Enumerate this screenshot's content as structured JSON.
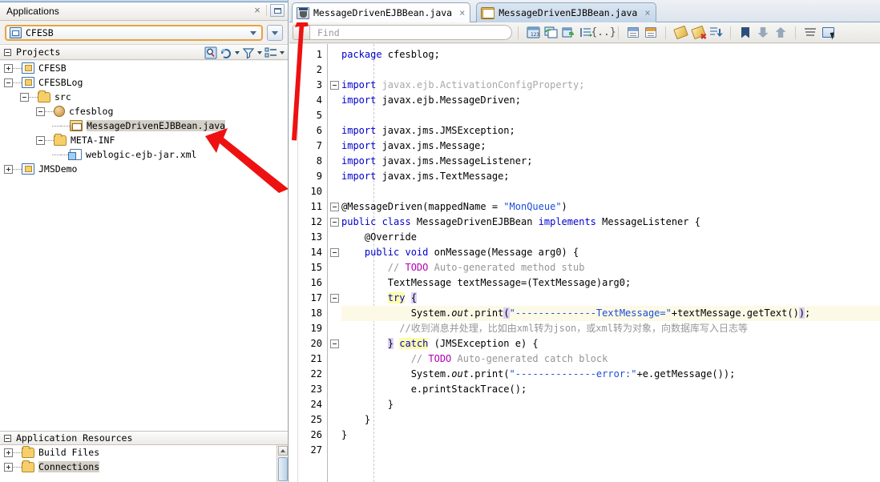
{
  "left_panel": {
    "title": "Applications",
    "close_label": "×",
    "minimize_name": "minimize-button",
    "app_combo": {
      "value": "CFESB",
      "icon": "application-icon"
    },
    "projects_header": {
      "label": "Projects"
    },
    "toolbar_icons": [
      "search-icon",
      "refresh-icon",
      "filter-icon",
      "group-by-icon"
    ],
    "tree": [
      {
        "label": "CFESB",
        "icon": "project-icon",
        "depth": 0,
        "expander": "plus",
        "selected": false
      },
      {
        "label": "CFESBLog",
        "icon": "project-icon",
        "depth": 0,
        "expander": "minus",
        "selected": false
      },
      {
        "label": "src",
        "icon": "folder-icon",
        "depth": 1,
        "expander": "minus",
        "selected": false
      },
      {
        "label": "cfesblog",
        "icon": "package-icon",
        "depth": 2,
        "expander": "minus",
        "selected": false
      },
      {
        "label": "MessageDrivenEJBBean.java",
        "icon": "java-file-icon",
        "depth": 3,
        "expander": "none",
        "selected": true
      },
      {
        "label": "META-INF",
        "icon": "folder-icon",
        "depth": 2,
        "expander": "minus",
        "selected": false
      },
      {
        "label": "weblogic-ejb-jar.xml",
        "icon": "xml-file-icon",
        "depth": 3,
        "expander": "none",
        "selected": false
      },
      {
        "label": "JMSDemo",
        "icon": "project-icon",
        "depth": 0,
        "expander": "plus",
        "selected": false
      }
    ],
    "resources_header": {
      "label": "Application Resources"
    },
    "resources": [
      {
        "label": "Build Files",
        "icon": "folder-icon",
        "expander": "plus",
        "selected": false
      },
      {
        "label": "Connections",
        "icon": "folder-icon",
        "expander": "plus",
        "selected": true
      }
    ]
  },
  "editor": {
    "tabs": [
      {
        "label": "MessageDrivenEJBBean.java",
        "icon": "java-class-icon",
        "active": true,
        "close": "×"
      },
      {
        "label": "MessageDrivenEJBBean.java",
        "icon": "message-driven-bean-icon",
        "active": false,
        "close": "×"
      }
    ],
    "find": {
      "placeholder": "Find",
      "value": ""
    },
    "toolbar_icons": [
      "goto-line-icon",
      "replace-icon",
      "navigate-forward-icon",
      "indent-block-icon",
      "braces-icon",
      "expand-all-icon",
      "collapse-all-icon",
      "highlight-icon",
      "clear-highlight-icon",
      "import-icon",
      "toggle-bookmark-icon",
      "next-bookmark-icon",
      "previous-bookmark-icon",
      "reformat-icon",
      "block-select-icon"
    ],
    "line_numbers": [
      "1",
      "2",
      "3",
      "4",
      "5",
      "6",
      "7",
      "8",
      "9",
      "10",
      "11",
      "12",
      "13",
      "14",
      "15",
      "16",
      "17",
      "18",
      "19",
      "20",
      "21",
      "22",
      "23",
      "24",
      "25",
      "26",
      "27"
    ],
    "lines": [
      {
        "n": 1,
        "fold": false,
        "caret": false,
        "tokens": [
          {
            "t": "package ",
            "c": "kw"
          },
          {
            "t": "cfesblog;",
            "c": ""
          }
        ]
      },
      {
        "n": 2,
        "fold": false,
        "caret": false,
        "tokens": []
      },
      {
        "n": 3,
        "fold": true,
        "caret": false,
        "tokens": [
          {
            "t": "import ",
            "c": "kw"
          },
          {
            "t": "javax.ejb.ActivationConfigProperty;",
            "c": "grey"
          }
        ]
      },
      {
        "n": 4,
        "fold": false,
        "caret": false,
        "tokens": [
          {
            "t": "import ",
            "c": "kw"
          },
          {
            "t": "javax.ejb.MessageDriven;",
            "c": ""
          }
        ]
      },
      {
        "n": 5,
        "fold": false,
        "caret": false,
        "tokens": []
      },
      {
        "n": 6,
        "fold": false,
        "caret": false,
        "tokens": [
          {
            "t": "import ",
            "c": "kw"
          },
          {
            "t": "javax.jms.JMSException;",
            "c": ""
          }
        ]
      },
      {
        "n": 7,
        "fold": false,
        "caret": false,
        "tokens": [
          {
            "t": "import ",
            "c": "kw"
          },
          {
            "t": "javax.jms.Message;",
            "c": ""
          }
        ]
      },
      {
        "n": 8,
        "fold": false,
        "caret": false,
        "tokens": [
          {
            "t": "import ",
            "c": "kw"
          },
          {
            "t": "javax.jms.MessageListener;",
            "c": ""
          }
        ]
      },
      {
        "n": 9,
        "fold": false,
        "caret": false,
        "tokens": [
          {
            "t": "import ",
            "c": "kw"
          },
          {
            "t": "javax.jms.TextMessage;",
            "c": ""
          }
        ]
      },
      {
        "n": 10,
        "fold": false,
        "caret": false,
        "tokens": []
      },
      {
        "n": 11,
        "fold": true,
        "caret": false,
        "tokens": [
          {
            "t": "@MessageDriven(mappedName = ",
            "c": ""
          },
          {
            "t": "\"MonQueue\"",
            "c": "str"
          },
          {
            "t": ")",
            "c": ""
          }
        ]
      },
      {
        "n": 12,
        "fold": true,
        "caret": false,
        "tokens": [
          {
            "t": "public class",
            "c": "kw"
          },
          {
            "t": " MessageDrivenEJBBean ",
            "c": ""
          },
          {
            "t": "implements",
            "c": "kw"
          },
          {
            "t": " MessageListener {",
            "c": ""
          }
        ]
      },
      {
        "n": 13,
        "fold": false,
        "caret": false,
        "tokens": [
          {
            "t": "    @Override",
            "c": ""
          }
        ]
      },
      {
        "n": 14,
        "fold": true,
        "caret": false,
        "tokens": [
          {
            "t": "    ",
            "c": ""
          },
          {
            "t": "public void",
            "c": "kw"
          },
          {
            "t": " onMessage(Message arg0) {",
            "c": ""
          }
        ]
      },
      {
        "n": 15,
        "fold": false,
        "caret": false,
        "tokens": [
          {
            "t": "        // ",
            "c": "cmt"
          },
          {
            "t": "TODO",
            "c": "todo"
          },
          {
            "t": " Auto-generated method stub",
            "c": "cmt"
          }
        ]
      },
      {
        "n": 16,
        "fold": false,
        "caret": false,
        "tokens": [
          {
            "t": "        TextMessage textMessage=(TextMessage)arg0;",
            "c": ""
          }
        ]
      },
      {
        "n": 17,
        "fold": true,
        "caret": false,
        "tokens": [
          {
            "t": "        ",
            "c": ""
          },
          {
            "t": "try",
            "c": "kw hl-y"
          },
          {
            "t": " ",
            "c": ""
          },
          {
            "t": "{",
            "c": "hl-p"
          }
        ]
      },
      {
        "n": 18,
        "fold": false,
        "caret": true,
        "tokens": [
          {
            "t": "            System.",
            "c": ""
          },
          {
            "t": "out",
            "c": "ital"
          },
          {
            "t": ".print",
            "c": ""
          },
          {
            "t": "(",
            "c": "hl-p"
          },
          {
            "t": "\"--------------TextMessage=\"",
            "c": "str"
          },
          {
            "t": "+textMessage.getText(",
            "c": ""
          },
          {
            "t": ")",
            "c": ""
          },
          {
            "t": ")",
            "c": "hl-p"
          },
          {
            "t": ";",
            "c": ""
          }
        ]
      },
      {
        "n": 19,
        "fold": false,
        "caret": false,
        "tokens": [
          {
            "t": "          //收到消息并处理，比如由xml转为json，或xml转为对象，向数据库写入日志等",
            "c": "cmt"
          }
        ]
      },
      {
        "n": 20,
        "fold": true,
        "caret": false,
        "tokens": [
          {
            "t": "        ",
            "c": ""
          },
          {
            "t": "}",
            "c": "hl-p"
          },
          {
            "t": " ",
            "c": ""
          },
          {
            "t": "catch",
            "c": "kw hl-y"
          },
          {
            "t": " (JMSException e) {",
            "c": ""
          }
        ]
      },
      {
        "n": 21,
        "fold": false,
        "caret": false,
        "tokens": [
          {
            "t": "            // ",
            "c": "cmt"
          },
          {
            "t": "TODO",
            "c": "todo"
          },
          {
            "t": " Auto-generated catch block",
            "c": "cmt"
          }
        ]
      },
      {
        "n": 22,
        "fold": false,
        "caret": false,
        "tokens": [
          {
            "t": "            System.",
            "c": ""
          },
          {
            "t": "out",
            "c": "ital"
          },
          {
            "t": ".print(",
            "c": ""
          },
          {
            "t": "\"--------------error:\"",
            "c": "str"
          },
          {
            "t": "+e.getMessage());",
            "c": ""
          }
        ]
      },
      {
        "n": 23,
        "fold": false,
        "caret": false,
        "tokens": [
          {
            "t": "            e.printStackTrace();",
            "c": ""
          }
        ]
      },
      {
        "n": 24,
        "fold": false,
        "caret": false,
        "tokens": [
          {
            "t": "        }",
            "c": ""
          }
        ]
      },
      {
        "n": 25,
        "fold": false,
        "caret": false,
        "tokens": [
          {
            "t": "    }",
            "c": ""
          }
        ]
      },
      {
        "n": 26,
        "fold": false,
        "caret": false,
        "tokens": [
          {
            "t": "}",
            "c": ""
          }
        ]
      },
      {
        "n": 27,
        "fold": false,
        "caret": false,
        "tokens": []
      }
    ]
  },
  "annotations": {
    "arrows": [
      {
        "name": "arrow-to-editor-tab",
        "color": "#ee1111"
      },
      {
        "name": "arrow-to-tree-file",
        "color": "#ee1111"
      }
    ]
  },
  "colors": {
    "accent_orange": "#e8a33d",
    "keyword_blue": "#0000cc",
    "string_blue": "#1a4fd6",
    "comment_grey": "#969696",
    "todo_purple": "#b000b0",
    "caret_line": "#fdf9e7",
    "selection_grey": "#d4d0c8",
    "arrow_red": "#ee1111"
  }
}
